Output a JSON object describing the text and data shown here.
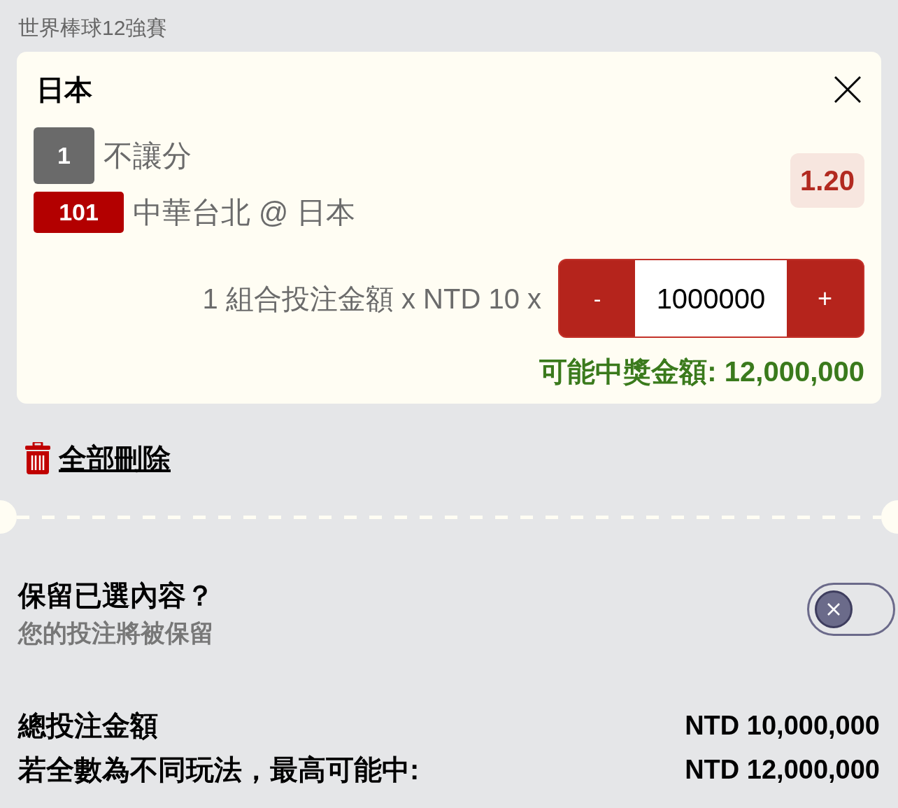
{
  "header": {
    "title": "世界棒球12強賽"
  },
  "bet": {
    "team": "日本",
    "market": {
      "code": "1",
      "label": "不讓分"
    },
    "match": {
      "code": "101",
      "label": "中華台北 @ 日本"
    },
    "odds": "1.20",
    "stake_label": "1 組合投注金額 x NTD 10 x",
    "stepper": {
      "minus": "-",
      "value": "1000000",
      "plus": "+"
    },
    "potential_win": "可能中獎金額: 12,000,000"
  },
  "delete_all": "全部刪除",
  "keep_selection": {
    "title": "保留已選內容？",
    "subtitle": "您的投注將被保留",
    "on": false
  },
  "summary": [
    {
      "label": "總投注金額",
      "value": "NTD 10,000,000"
    },
    {
      "label": "若全數為不同玩法，最高可能中:",
      "value": "NTD 12,000,000"
    }
  ]
}
